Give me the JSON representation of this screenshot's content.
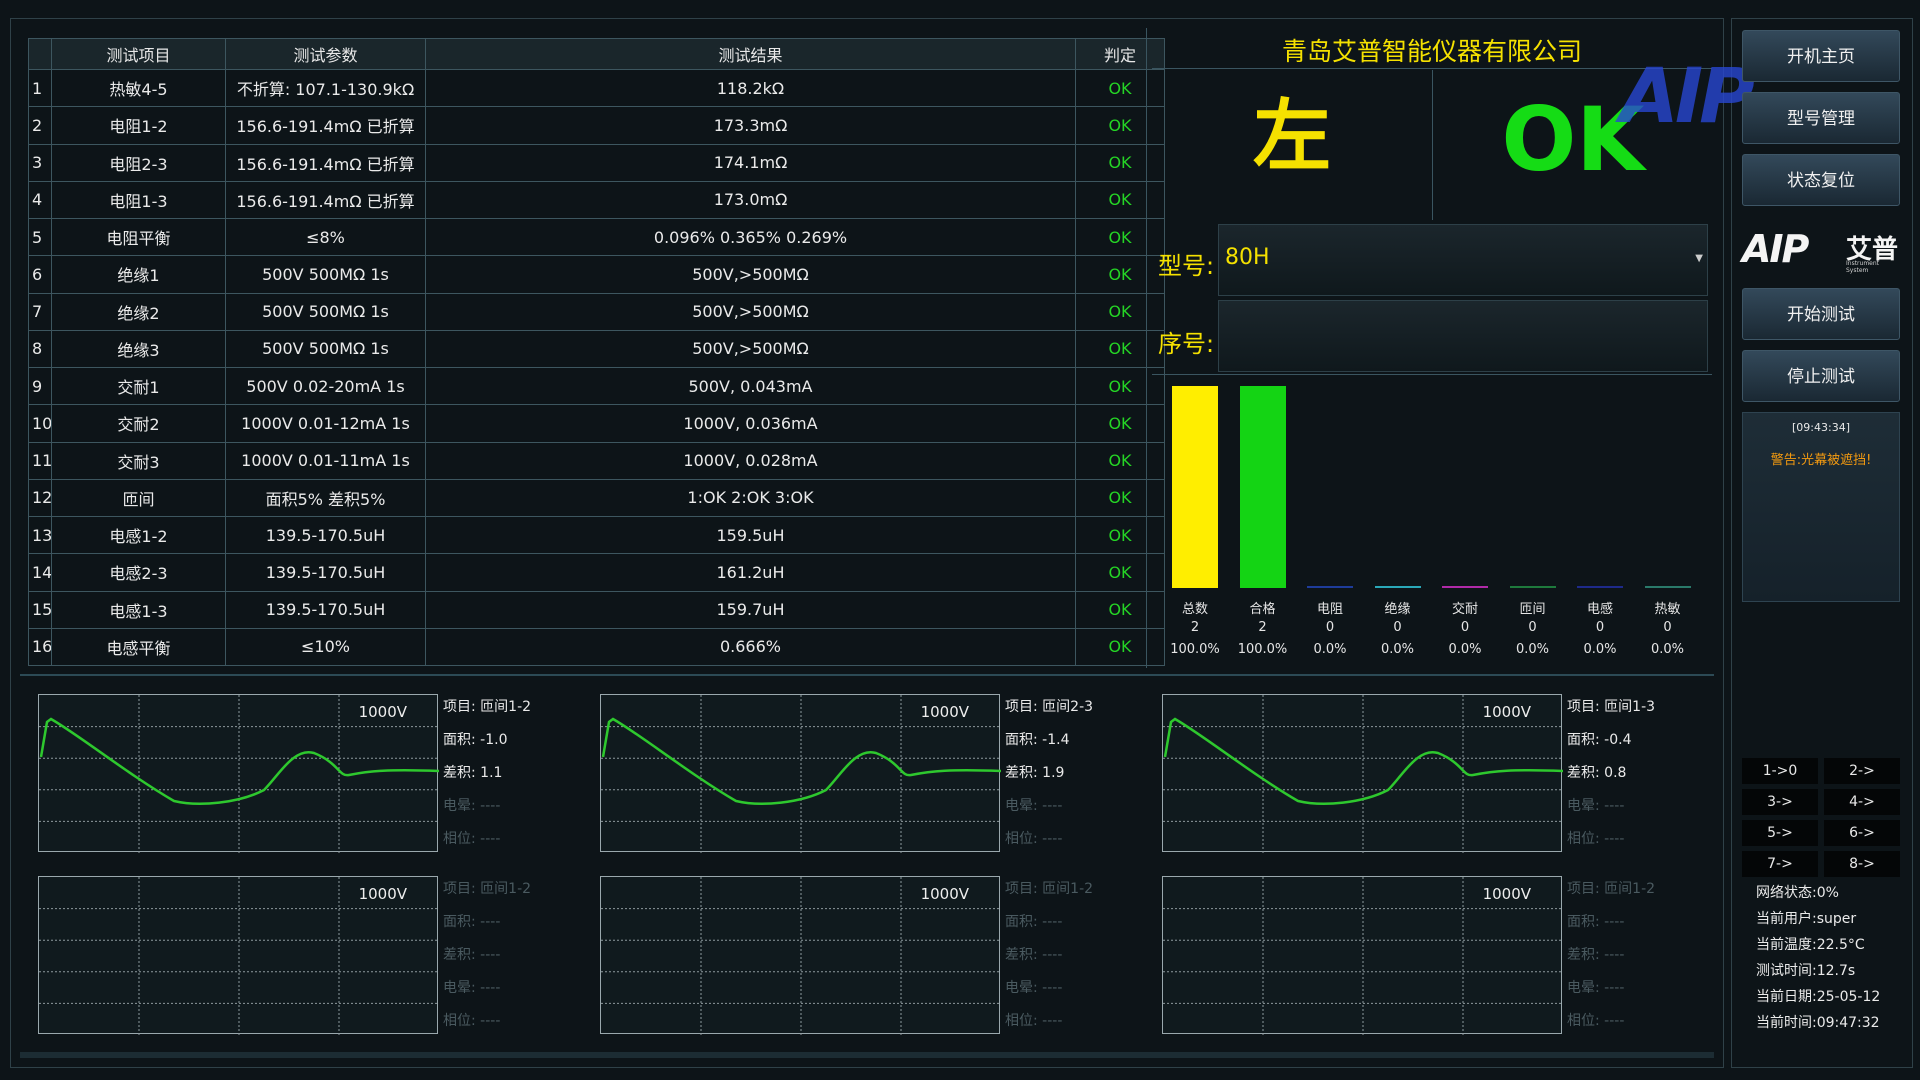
{
  "table": {
    "headers": [
      "",
      "测试项目",
      "测试参数",
      "测试结果",
      "判定"
    ],
    "rows": [
      {
        "num": "1",
        "item": "热敏4-5",
        "param": "不折算: 107.1-130.9kΩ",
        "result": "118.2kΩ",
        "verdict": "OK"
      },
      {
        "num": "2",
        "item": "电阻1-2",
        "param": "156.6-191.4mΩ 已折算",
        "result": "173.3mΩ",
        "verdict": "OK"
      },
      {
        "num": "3",
        "item": "电阻2-3",
        "param": "156.6-191.4mΩ 已折算",
        "result": "174.1mΩ",
        "verdict": "OK"
      },
      {
        "num": "4",
        "item": "电阻1-3",
        "param": "156.6-191.4mΩ 已折算",
        "result": "173.0mΩ",
        "verdict": "OK"
      },
      {
        "num": "5",
        "item": "电阻平衡",
        "param": "≤8%",
        "result": "0.096% 0.365% 0.269%",
        "verdict": "OK"
      },
      {
        "num": "6",
        "item": "绝缘1",
        "param": "500V 500MΩ 1s",
        "result": "500V,>500MΩ",
        "verdict": "OK"
      },
      {
        "num": "7",
        "item": "绝缘2",
        "param": "500V 500MΩ 1s",
        "result": "500V,>500MΩ",
        "verdict": "OK"
      },
      {
        "num": "8",
        "item": "绝缘3",
        "param": "500V 500MΩ 1s",
        "result": "500V,>500MΩ",
        "verdict": "OK"
      },
      {
        "num": "9",
        "item": "交耐1",
        "param": "500V 0.02-20mA 1s",
        "result": "500V, 0.043mA",
        "verdict": "OK"
      },
      {
        "num": "10",
        "item": "交耐2",
        "param": "1000V 0.01-12mA 1s",
        "result": "1000V, 0.036mA",
        "verdict": "OK"
      },
      {
        "num": "11",
        "item": "交耐3",
        "param": "1000V 0.01-11mA 1s",
        "result": "1000V, 0.028mA",
        "verdict": "OK"
      },
      {
        "num": "12",
        "item": "匝间",
        "param": "面积5% 差积5%",
        "result": "1:OK 2:OK 3:OK",
        "verdict": "OK"
      },
      {
        "num": "13",
        "item": "电感1-2",
        "param": "139.5-170.5uH",
        "result": "159.5uH",
        "verdict": "OK"
      },
      {
        "num": "14",
        "item": "电感2-3",
        "param": "139.5-170.5uH",
        "result": "161.2uH",
        "verdict": "OK"
      },
      {
        "num": "15",
        "item": "电感1-3",
        "param": "139.5-170.5uH",
        "result": "159.7uH",
        "verdict": "OK"
      },
      {
        "num": "16",
        "item": "电感平衡",
        "param": "≤10%",
        "result": "0.666%",
        "verdict": "OK"
      }
    ]
  },
  "header": {
    "company": "青岛艾普智能仪器有限公司",
    "side": "左",
    "overall": "OK",
    "watermark": "AIP"
  },
  "model": {
    "label": "型号:",
    "value": "80H"
  },
  "serial": {
    "label": "序号:",
    "value": ""
  },
  "stats": {
    "max": 2,
    "items": [
      {
        "label": "总数",
        "count": "2",
        "pct": "100.0%",
        "value": 2,
        "color": "#ffee00"
      },
      {
        "label": "合格",
        "count": "2",
        "pct": "100.0%",
        "value": 2,
        "color": "#14d414"
      },
      {
        "label": "电阻",
        "count": "0",
        "pct": "0.0%",
        "value": 0,
        "color": "#1e3c9a"
      },
      {
        "label": "绝缘",
        "count": "0",
        "pct": "0.0%",
        "value": 0,
        "color": "#2aa8b8"
      },
      {
        "label": "交耐",
        "count": "0",
        "pct": "0.0%",
        "value": 0,
        "color": "#b02aa8"
      },
      {
        "label": "匝间",
        "count": "0",
        "pct": "0.0%",
        "value": 0,
        "color": "#1e7a3c"
      },
      {
        "label": "电感",
        "count": "0",
        "pct": "0.0%",
        "value": 0,
        "color": "#1e2a8a"
      },
      {
        "label": "热敏",
        "count": "0",
        "pct": "0.0%",
        "value": 0,
        "color": "#2a7a6a"
      }
    ]
  },
  "waves": [
    {
      "volt": "1000V",
      "has_curve": true,
      "active": true,
      "item": "项目: 匝间1-2",
      "area": "面积: -1.0",
      "diff": "差积: 1.1",
      "corona": "电晕: ----",
      "phase": "相位: ----"
    },
    {
      "volt": "1000V",
      "has_curve": true,
      "active": true,
      "item": "项目: 匝间2-3",
      "area": "面积: -1.4",
      "diff": "差积: 1.9",
      "corona": "电晕: ----",
      "phase": "相位: ----"
    },
    {
      "volt": "1000V",
      "has_curve": true,
      "active": true,
      "item": "项目: 匝间1-3",
      "area": "面积: -0.4",
      "diff": "差积: 0.8",
      "corona": "电晕: ----",
      "phase": "相位: ----"
    },
    {
      "volt": "1000V",
      "has_curve": false,
      "active": false,
      "item": "项目: 匝间1-2",
      "area": "面积: ----",
      "diff": "差积: ----",
      "corona": "电晕: ----",
      "phase": "相位: ----"
    },
    {
      "volt": "1000V",
      "has_curve": false,
      "active": false,
      "item": "项目: 匝间1-2",
      "area": "面积: ----",
      "diff": "差积: ----",
      "corona": "电晕: ----",
      "phase": "相位: ----"
    },
    {
      "volt": "1000V",
      "has_curve": false,
      "active": false,
      "item": "项目: 匝间1-2",
      "area": "面积: ----",
      "diff": "差积: ----",
      "corona": "电晕: ----",
      "phase": "相位: ----"
    }
  ],
  "sidebar": {
    "home": "开机主页",
    "model_mgmt": "型号管理",
    "reset": "状态复位",
    "logo_en": "AIP",
    "logo_cn": "艾普",
    "logo_sub": "Instrument System",
    "start": "开始测试",
    "stop": "停止测试",
    "log_time": "[09:43:34]",
    "log_msg": "警告:光幕被遮挡!",
    "mapping": [
      "1->0",
      "2->",
      "3->",
      "4->",
      "5->",
      "6->",
      "7->",
      "8->"
    ],
    "network": "网络状态:0%",
    "user": "当前用户:super",
    "temp": "当前温度:22.5°C",
    "test_time": "测试时间:12.7s",
    "date": "当前日期:25-05-12",
    "clock": "当前时间:09:47:32"
  },
  "colors": {
    "ok": "#25d425",
    "yellow": "#f5e100",
    "warn": "#f39a10",
    "wave": "#2ec82e"
  }
}
